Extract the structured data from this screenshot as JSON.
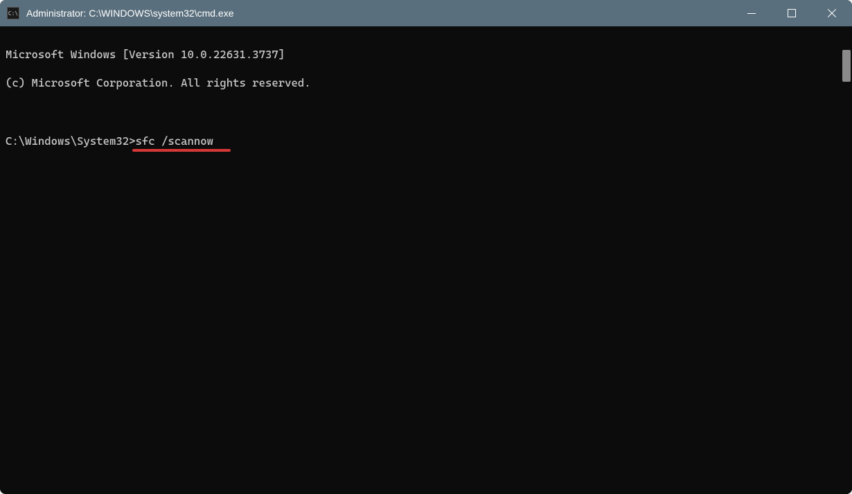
{
  "window": {
    "title": "Administrator: C:\\WINDOWS\\system32\\cmd.exe",
    "icon_label": "C:\\"
  },
  "terminal": {
    "line1": "Microsoft Windows [Version 10.0.22631.3737]",
    "line2": "(c) Microsoft Corporation. All rights reserved.",
    "blank": "",
    "prompt": "C:\\Windows\\System32>",
    "command": "sfc /scannow"
  },
  "annotation": {
    "type": "underline",
    "color": "#d63838",
    "underlined_text": "sfc /scannow"
  }
}
